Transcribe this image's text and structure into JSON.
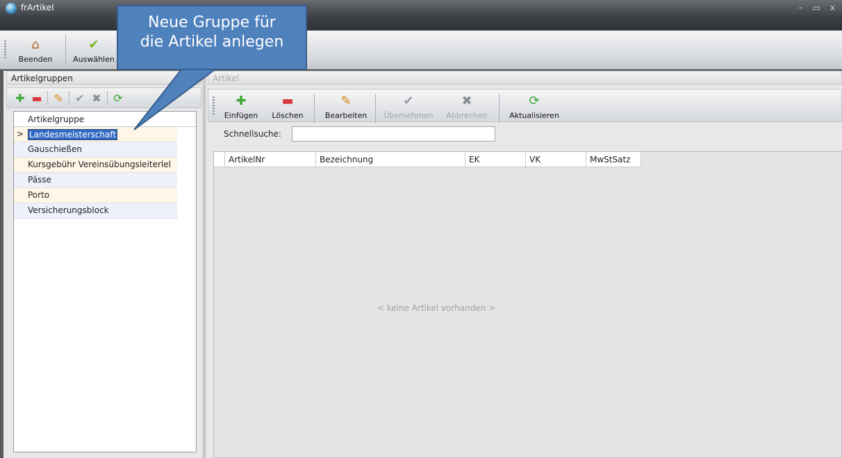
{
  "window": {
    "title": "frArtikel",
    "minimize": "–",
    "maximize": "▭",
    "close": "x"
  },
  "ribbon": {
    "exit_label": "Beenden",
    "select_label": "Auswählen"
  },
  "callout": {
    "line1": "Neue Gruppe für",
    "line2": "die Artikel anlegen"
  },
  "left_panel": {
    "header": "Artikelgruppen",
    "column_header": "Artikelgruppe",
    "rows": [
      {
        "label": "Landesmeisterschaft"
      },
      {
        "label": "Gauschießen"
      },
      {
        "label": "Kursgebühr Vereinsübungsleiterlel"
      },
      {
        "label": "Pässe"
      },
      {
        "label": "Porto"
      },
      {
        "label": "Versicherungsblock"
      }
    ]
  },
  "right_panel": {
    "header": "Artikel",
    "toolbar": {
      "insert": "Einfügen",
      "delete": "Löschen",
      "edit": "Bearbeiten",
      "apply": "Übernehmen",
      "cancel": "Abbrechen",
      "refresh": "Aktualisieren"
    },
    "search_label": "Schnellsuche:",
    "search_value": "",
    "columns": [
      "ArtikelNr",
      "Bezeichnung",
      "EK",
      "VK",
      "MwStSatz"
    ],
    "empty_text": "< keine Artikel vorhanden >"
  },
  "colors": {
    "callout": "#4f81bd",
    "selection": "#316ac5",
    "add_green": "#3fa535",
    "delete_red": "#d9363e"
  }
}
